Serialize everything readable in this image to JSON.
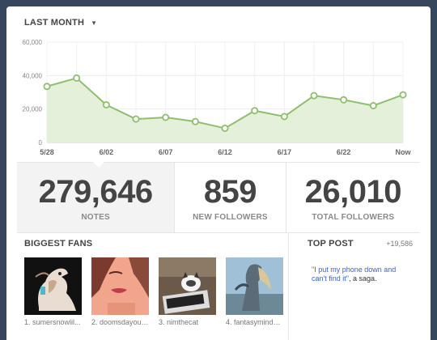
{
  "header": {
    "range_label": "LAST MONTH",
    "dropdown_icon": "caret-down-icon"
  },
  "chart_data": {
    "type": "area",
    "x": [
      "5/28",
      "5/31",
      "6/02",
      "6/04",
      "6/07",
      "6/09",
      "6/12",
      "6/14",
      "6/17",
      "6/19",
      "6/22",
      "6/24",
      "Now"
    ],
    "tick_labels": [
      "5/28",
      "6/02",
      "6/07",
      "6/12",
      "6/17",
      "6/22",
      "Now"
    ],
    "series": [
      {
        "values": [
          33500,
          38500,
          22500,
          14000,
          15000,
          12500,
          8500,
          19000,
          15500,
          28000,
          25500,
          22000,
          28500
        ]
      }
    ],
    "ylim": [
      0,
      60000
    ],
    "yticks": [
      "0",
      "20,000",
      "40,000",
      "60,000"
    ],
    "grid": true,
    "line_color": "#8fbf6d",
    "fill_color": "#e4f0d9"
  },
  "stats": [
    {
      "value": "279,646",
      "label": "NOTES"
    },
    {
      "value": "859",
      "label": "NEW FOLLOWERS"
    },
    {
      "value": "26,010",
      "label": "TOTAL FOLLOWERS"
    }
  ],
  "fans": {
    "title": "BIGGEST FANS",
    "items": [
      {
        "name": "1. sumersnowlil..."
      },
      {
        "name": "2. doomsdayoutl..."
      },
      {
        "name": "3. nimthecat"
      },
      {
        "name": "4. fantasymind2..."
      }
    ]
  },
  "top_post": {
    "title": "TOP POST",
    "count": "+19,586",
    "text_quote": "\"I put my phone down and can't find it\"",
    "text_rest": ", a saga."
  }
}
